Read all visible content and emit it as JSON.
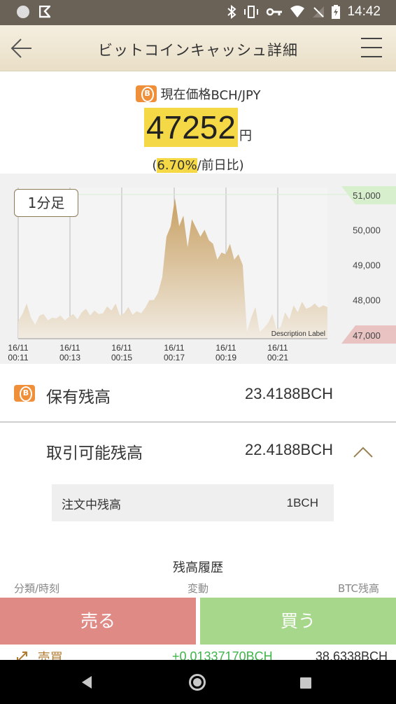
{
  "status_bar": {
    "time": "14:42",
    "icons": [
      "circle-icon",
      "flag-icon",
      "bluetooth-icon",
      "vibrate-icon",
      "key-icon",
      "wifi-icon",
      "no-signal-icon",
      "battery-icon"
    ]
  },
  "header": {
    "title": "ビットコインキャッシュ詳細",
    "back_icon": "arrow-left-icon",
    "menu_icon": "hamburger-menu-icon"
  },
  "price": {
    "label": "現在価格",
    "pair": "BCH/JPY",
    "value": "47252",
    "unit": "円",
    "change_open": "(",
    "change_pct": "6.70%",
    "change_suffix": "/前日比)"
  },
  "chart": {
    "timeframe": "1分足",
    "description_label": "Description Label",
    "high_label": "51,000",
    "low_label": "47,000",
    "y_ticks": [
      "50,000",
      "49,000",
      "48,000"
    ],
    "x_ticks": [
      {
        "date": "16/11",
        "time": "00:11"
      },
      {
        "date": "16/11",
        "time": "00:13"
      },
      {
        "date": "16/11",
        "time": "00:15"
      },
      {
        "date": "16/11",
        "time": "00:17"
      },
      {
        "date": "16/11",
        "time": "00:19"
      },
      {
        "date": "16/11",
        "time": "00:21"
      }
    ]
  },
  "chart_data": {
    "type": "area",
    "title": "",
    "xlabel": "",
    "ylabel": "",
    "ylim": [
      46900,
      51200
    ],
    "x_ticks": [
      "16/11 00:11",
      "16/11 00:13",
      "16/11 00:15",
      "16/11 00:17",
      "16/11 00:19",
      "16/11 00:21"
    ],
    "y_ticks": [
      47000,
      48000,
      49000,
      50000,
      51000
    ],
    "series": [
      {
        "values": [
          47400,
          47600,
          47900,
          47500,
          47300,
          47550,
          47600,
          47420,
          47500,
          47480,
          47560,
          47420,
          47520,
          47600,
          47450,
          47650,
          47750,
          47560,
          47700,
          47600,
          47620,
          47820,
          47700,
          47900,
          47560,
          47620,
          47800,
          47580,
          47680,
          47620,
          47780,
          48000,
          48000,
          48200,
          48650,
          49800,
          50100,
          50900,
          50100,
          50400,
          49500,
          50300,
          50050,
          49800,
          50000,
          49700,
          49600,
          49150,
          49350,
          49300,
          49600,
          49150,
          49300,
          49000,
          47100,
          47500,
          47800,
          47100,
          47200,
          47350,
          47600,
          47150,
          47250,
          47650,
          47450,
          47850,
          47650,
          47950,
          47750,
          47800,
          47900,
          47780,
          47850,
          47800
        ]
      }
    ],
    "grid": true
  },
  "balance": {
    "holding_label": "保有残高",
    "holding_value": "23.4188BCH",
    "tradable_label": "取引可能残高",
    "tradable_value": "22.4188BCH",
    "order_label": "注文中残高",
    "order_value": "1BCH"
  },
  "history": {
    "title": "残高履歴",
    "col_category": "分類/時刻",
    "col_change": "変動",
    "col_balance": "BTC残高",
    "rows": [
      {
        "category": "売買",
        "change": "+0.01337170BCH",
        "balance": "38.6338BCH"
      }
    ]
  },
  "actions": {
    "sell_label": "売る",
    "buy_label": "買う"
  },
  "colors": {
    "accent": "#f5d846",
    "sell": "#e08a86",
    "buy": "#a6d78a",
    "coin": "#ef8f3a",
    "chart_fill": "#d6b98a"
  }
}
